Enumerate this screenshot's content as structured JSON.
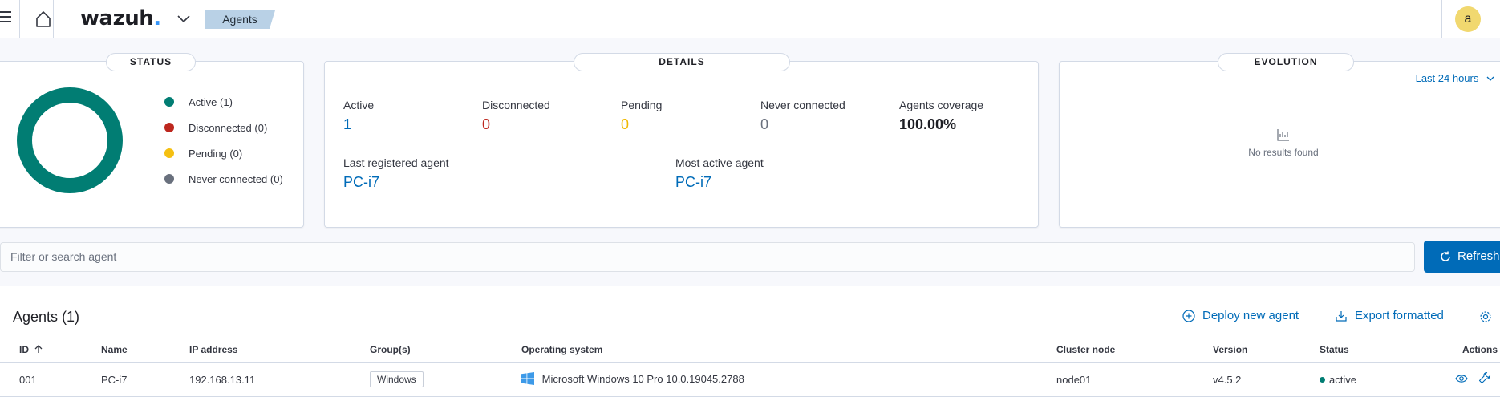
{
  "header": {
    "logo_text": "wazuh",
    "logo_dot": ".",
    "breadcrumb": "Agents",
    "avatar_letter": "a"
  },
  "status_panel": {
    "title": "STATUS",
    "legend": [
      {
        "label": "Active (1)",
        "color": "#017d73"
      },
      {
        "label": "Disconnected (0)",
        "color": "#bd271e"
      },
      {
        "label": "Pending (0)",
        "color": "#f5c012"
      },
      {
        "label": "Never connected (0)",
        "color": "#69707d"
      }
    ]
  },
  "details_panel": {
    "title": "DETAILS",
    "stats": {
      "active_label": "Active",
      "active_value": "1",
      "disconnected_label": "Disconnected",
      "disconnected_value": "0",
      "pending_label": "Pending",
      "pending_value": "0",
      "never_label": "Never connected",
      "never_value": "0",
      "coverage_label": "Agents coverage",
      "coverage_value": "100.00%"
    },
    "last_registered_label": "Last registered agent",
    "last_registered_value": "PC-i7",
    "most_active_label": "Most active agent",
    "most_active_value": "PC-i7"
  },
  "evolution_panel": {
    "title": "EVOLUTION",
    "range": "Last 24 hours",
    "empty_text": "No results found"
  },
  "search": {
    "placeholder": "Filter or search agent",
    "refresh_label": "Refresh"
  },
  "table": {
    "title": "Agents (1)",
    "deploy_label": "Deploy new agent",
    "export_label": "Export formatted",
    "columns": {
      "id": "ID",
      "name": "Name",
      "ip": "IP address",
      "groups": "Group(s)",
      "os": "Operating system",
      "cluster": "Cluster node",
      "version": "Version",
      "status": "Status",
      "actions": "Actions"
    },
    "rows": [
      {
        "id": "001",
        "name": "PC-i7",
        "ip": "192.168.13.11",
        "group": "Windows",
        "os": "Microsoft Windows 10 Pro 10.0.19045.2788",
        "cluster": "node01",
        "version": "v4.5.2",
        "status": "active"
      }
    ]
  }
}
